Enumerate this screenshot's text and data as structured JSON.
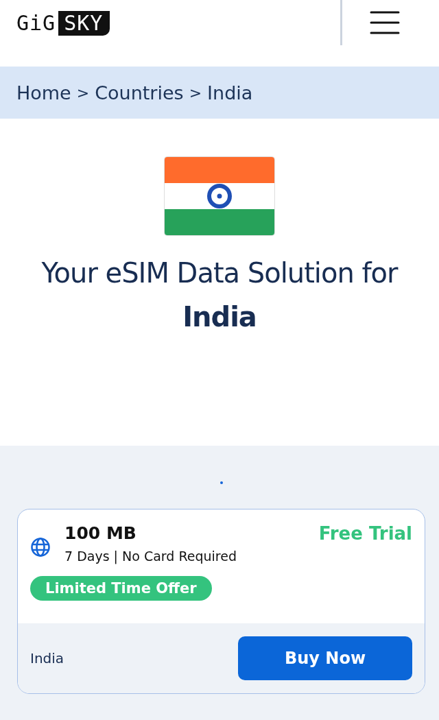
{
  "header": {
    "logo": {
      "part_1": "GiG",
      "part_2": "SKY"
    }
  },
  "breadcrumb": [
    {
      "label": "Home",
      "kind": "link"
    },
    {
      "label": ">",
      "kind": "separator"
    },
    {
      "label": "Countries",
      "kind": "link"
    },
    {
      "label": ">",
      "kind": "separator"
    },
    {
      "label": "India",
      "kind": "current"
    }
  ],
  "hero": {
    "heading": "Your eSIM Data Solution for **India**"
  },
  "carousel_dots": [
    {
      "selected": true
    }
  ],
  "plans": [
    {
      "data": "100 MB",
      "details": "7 Days | No Card Required",
      "price": "Free Trial",
      "badge": "Limited Time Offer",
      "country": "India",
      "button": "Buy Now"
    }
  ]
}
